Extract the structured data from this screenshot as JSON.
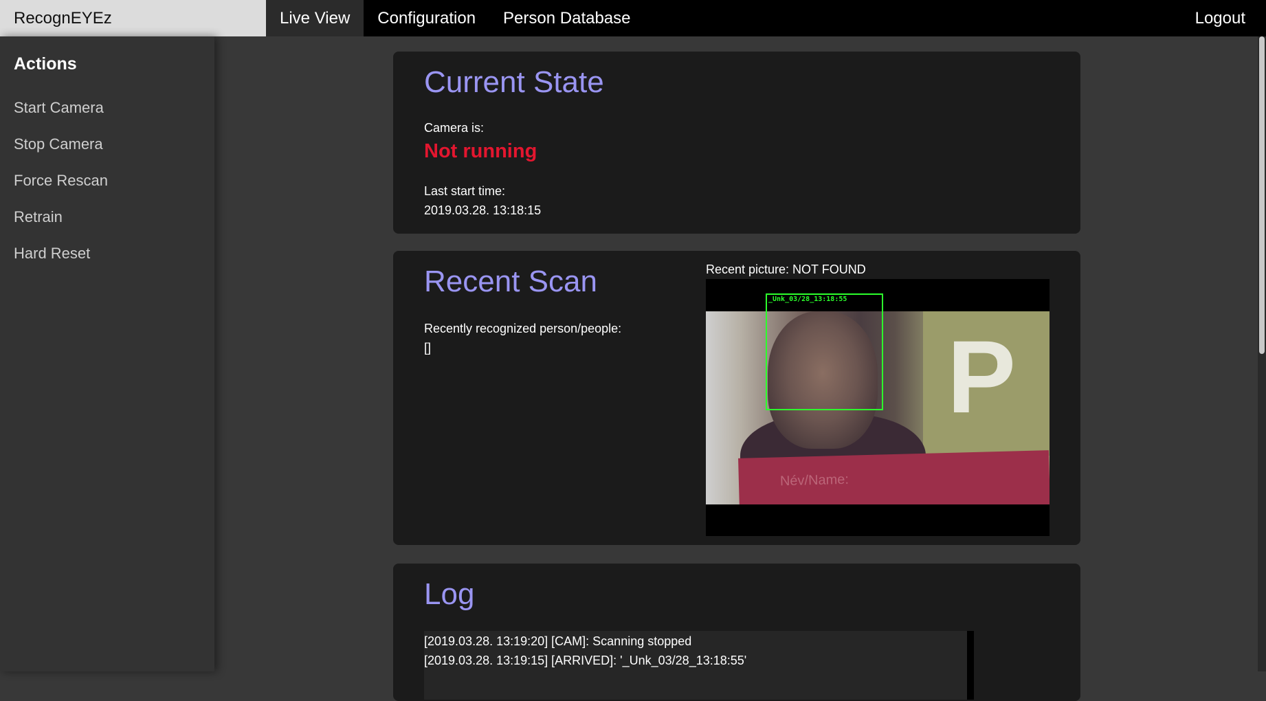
{
  "app": {
    "brand": "RecognEYEz"
  },
  "nav": {
    "items": [
      {
        "label": "Live View",
        "active": true
      },
      {
        "label": "Configuration",
        "active": false
      },
      {
        "label": "Person Database",
        "active": false
      }
    ],
    "logout": "Logout"
  },
  "sidebar": {
    "title": "Actions",
    "items": [
      {
        "label": "Start Camera"
      },
      {
        "label": "Stop Camera"
      },
      {
        "label": "Force Rescan"
      },
      {
        "label": "Retrain"
      },
      {
        "label": "Hard Reset"
      }
    ]
  },
  "current_state": {
    "title": "Current State",
    "camera_label": "Camera is:",
    "camera_status": "Not running",
    "status_color": "#e3162f",
    "last_start_label": "Last start time:",
    "last_start_value": "2019.03.28. 13:18:15"
  },
  "recent_scan": {
    "title": "Recent Scan",
    "recognized_label": "Recently recognized person/people:",
    "recognized_value": "[]",
    "picture_label": "Recent picture: NOT FOUND",
    "bbox_label": "_Unk_03/28_13:18:55",
    "bbox_color": "#2cff2c"
  },
  "log": {
    "title": "Log",
    "lines": [
      "[2019.03.28. 13:19:20] [CAM]: Scanning stopped",
      "[2019.03.28. 13:19:15] [ARRIVED]: '_Unk_03/28_13:18:55'"
    ]
  },
  "theme": {
    "accent": "#9a95f2",
    "background": "#383838",
    "card": "#1b1b1b"
  }
}
